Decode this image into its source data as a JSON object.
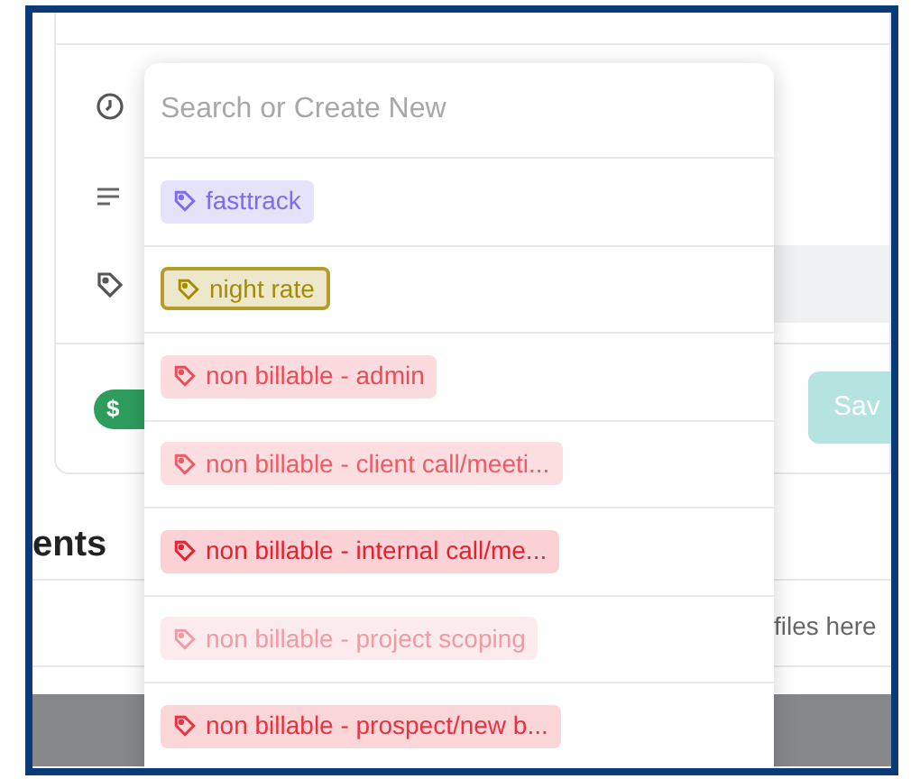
{
  "form": {
    "toggle_label": "$",
    "save_button": "Sav"
  },
  "section": {
    "heading": "ents",
    "dropzone_text": "files here"
  },
  "tag_dropdown": {
    "search": {
      "placeholder": "Search or Create New"
    },
    "tags": [
      {
        "label": "fasttrack",
        "color": "#7b6cf0",
        "outlined": false
      },
      {
        "label": "night rate",
        "color": "#a48c00",
        "outlined": true
      },
      {
        "label": "non billable - admin",
        "color": "#ec4b57",
        "outlined": false
      },
      {
        "label": "non billable - client call/meeti...",
        "color": "#ee5b66",
        "outlined": false
      },
      {
        "label": "non billable - internal call/me...",
        "color": "#e5202f",
        "outlined": false
      },
      {
        "label": "non billable - project scoping",
        "color": "#f19aa2",
        "outlined": false
      },
      {
        "label": "non billable - prospect/new b...",
        "color": "#e8323f",
        "outlined": false
      }
    ]
  }
}
